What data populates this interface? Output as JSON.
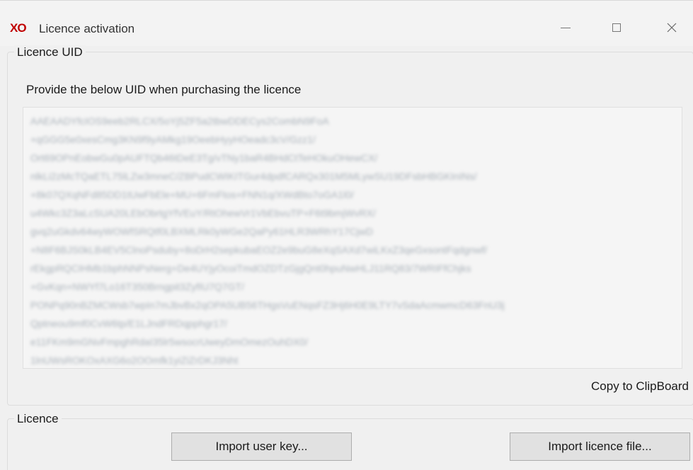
{
  "window": {
    "title": "Licence activation",
    "icon_name": "xo-logo-icon",
    "accent_color": "#c00000"
  },
  "licence_uid": {
    "legend": "Licence UID",
    "prompt": "Provide the below UID when purchasing the licence",
    "copy_label": "Copy to ClipBoard"
  },
  "licence": {
    "legend": "Licence",
    "import_user_key_label": "Import user key...",
    "import_licence_file_label": "Import licence file..."
  }
}
